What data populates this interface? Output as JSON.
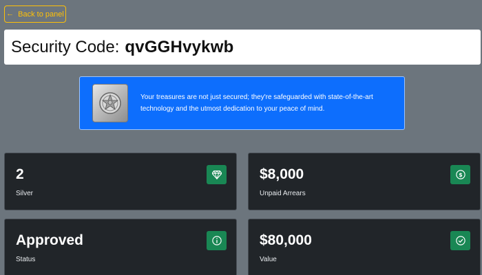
{
  "back_button": {
    "arrow": "←",
    "label": "Back to panel"
  },
  "security_code": {
    "label": "Security Code:",
    "value": "qvGGHvykwb"
  },
  "info_alert": {
    "icon": "safe-image",
    "text": "Your treasures are not just secured; they're safeguarded with state-of-the-art technology and the utmost dedication to your peace of mind."
  },
  "cards": [
    {
      "value": "2",
      "label": "Silver",
      "icon": "gem-icon"
    },
    {
      "value": "$8,000",
      "label": "Unpaid Arrears",
      "icon": "dollar-circle-icon"
    },
    {
      "value": "Approved",
      "label": "Status",
      "icon": "info-circle-icon"
    },
    {
      "value": "$80,000",
      "label": "Value",
      "icon": "check-circle-icon"
    }
  ],
  "colors": {
    "background": "#6c757d",
    "accent_warning": "#ffc107",
    "alert_primary": "#0d6efd",
    "card_bg": "#212529",
    "icon_success": "#198754"
  }
}
